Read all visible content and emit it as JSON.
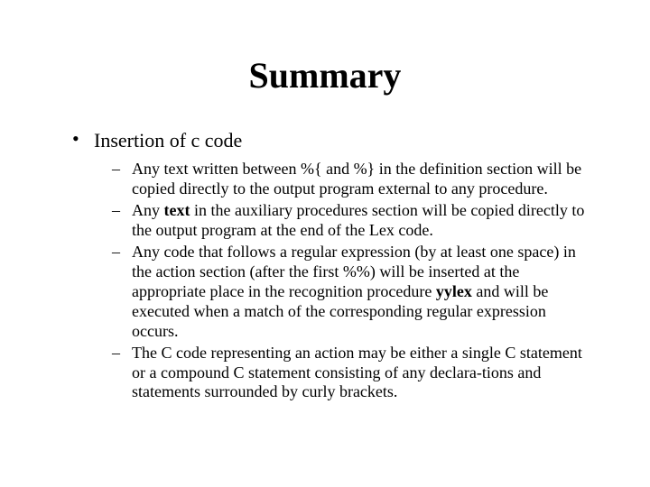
{
  "title": "Summary",
  "bullet1": "Insertion of c code",
  "sub1_a": "Any text written between %{ and %} in the definition section will be copied directly to the output program external to any procedure.",
  "sub2_a": "Any ",
  "sub2_b": "text",
  "sub2_c": " in the auxiliary procedures section will be copied directly to the output program at the end of the Lex code.",
  "sub3_a": "Any code that follows a regular expression (by at least one space) in the action section (after the first %%) will be inserted at the appropriate place in the recognition procedure ",
  "sub3_b": "yylex",
  "sub3_c": " and will be executed when a match of the corresponding regular expression occurs.",
  "sub4_a": "The C code representing an action may be either a single C statement or a compound C statement consisting of any declara-tions and statements surrounded by curly brackets."
}
